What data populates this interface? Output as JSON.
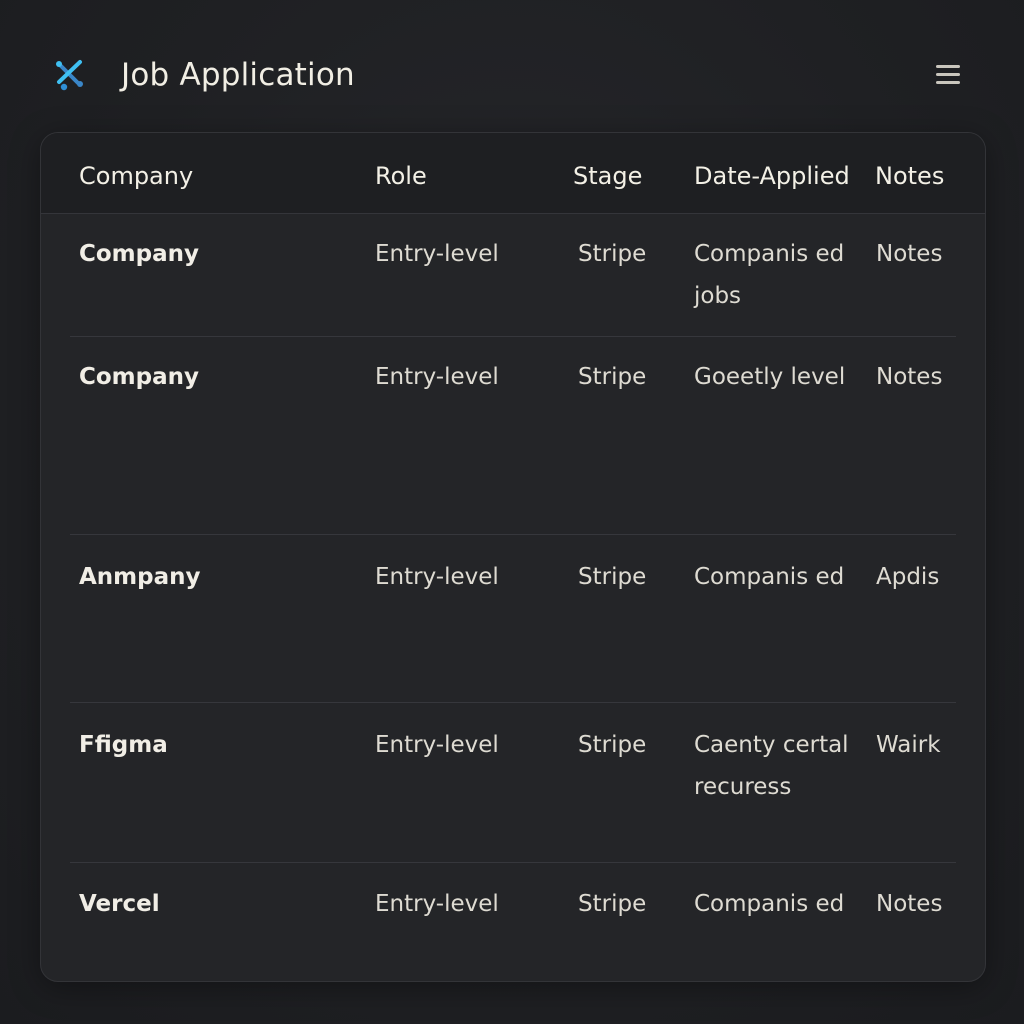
{
  "app": {
    "title": "Job Application"
  },
  "icons": {
    "logo": "tools-logo-icon",
    "menu": "hamburger-menu-icon"
  },
  "colors": {
    "background": "#1f2023",
    "card": "#242528",
    "accent_blue": "#3fb6f0",
    "text": "#ece9e0"
  },
  "table": {
    "headers": {
      "company": "Company",
      "role": "Role",
      "stage": "Stage",
      "date_applied": "Date-Applied",
      "notes": "Notes"
    },
    "rows": [
      {
        "company": "Company",
        "role": "Entry-level",
        "stage": "Stripe",
        "date_applied": "Companis ed jobs",
        "notes": "Notes"
      },
      {
        "company": "Company",
        "role": "Entry-level",
        "stage": "Stripe",
        "date_applied": "Goeetly level",
        "notes": "Notes"
      },
      {
        "company": "Anmpany",
        "role": "Entry-level",
        "stage": "Stripe",
        "date_applied": "Companis ed",
        "notes": "Apdis"
      },
      {
        "company": "Ffigma",
        "role": "Entry-level",
        "stage": "Stripe",
        "date_applied": "Caenty certal recuress",
        "notes": "Wairk"
      },
      {
        "company": "Vercel",
        "role": "Entry-level",
        "stage": "Stripe",
        "date_applied": "Companis ed",
        "notes": "Notes"
      }
    ]
  }
}
